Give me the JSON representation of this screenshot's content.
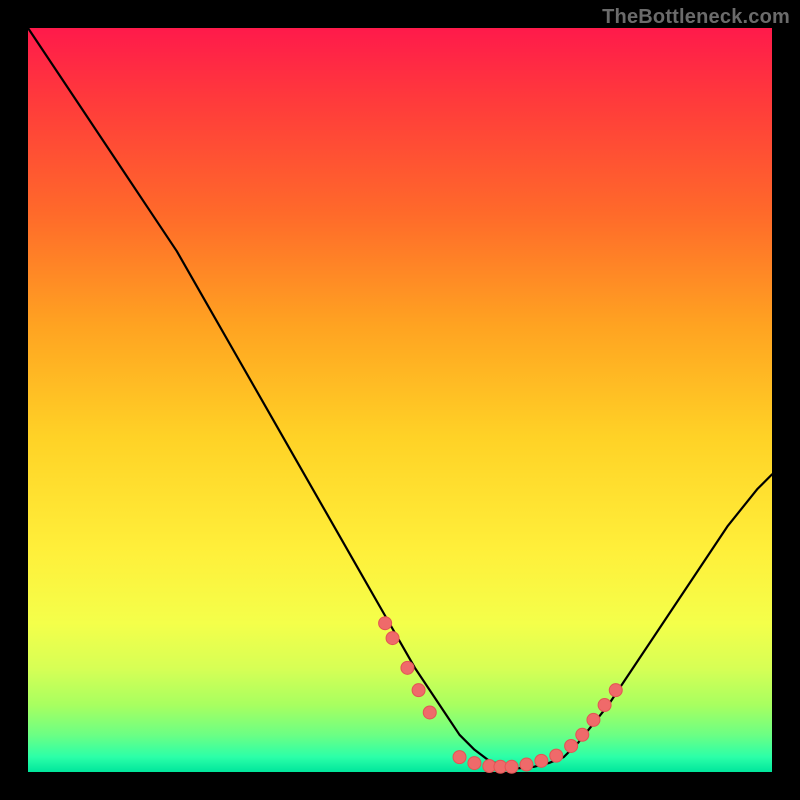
{
  "watermark": "TheBottleneck.com",
  "colors": {
    "background": "#000000",
    "curve": "#000000",
    "dot_fill": "#ef6a6a",
    "dot_stroke": "#e35454"
  },
  "chart_data": {
    "type": "line",
    "title": "",
    "xlabel": "",
    "ylabel": "",
    "xlim": [
      0,
      100
    ],
    "ylim": [
      0,
      100
    ],
    "series": [
      {
        "name": "curve",
        "x": [
          0,
          4,
          8,
          12,
          16,
          20,
          24,
          28,
          32,
          36,
          40,
          44,
          48,
          52,
          56,
          58,
          60,
          62,
          64,
          66,
          68,
          70,
          72,
          74,
          78,
          82,
          86,
          90,
          94,
          98,
          100
        ],
        "y": [
          100,
          94,
          88,
          82,
          76,
          70,
          63,
          56,
          49,
          42,
          35,
          28,
          21,
          14,
          8,
          5,
          3,
          1.5,
          0.8,
          0.5,
          0.7,
          1.2,
          2,
          4,
          9,
          15,
          21,
          27,
          33,
          38,
          40
        ]
      }
    ],
    "dots": [
      {
        "x": 48,
        "y": 20
      },
      {
        "x": 49,
        "y": 18
      },
      {
        "x": 51,
        "y": 14
      },
      {
        "x": 52.5,
        "y": 11
      },
      {
        "x": 54,
        "y": 8
      },
      {
        "x": 58,
        "y": 2
      },
      {
        "x": 60,
        "y": 1.2
      },
      {
        "x": 62,
        "y": 0.8
      },
      {
        "x": 63.5,
        "y": 0.7
      },
      {
        "x": 65,
        "y": 0.7
      },
      {
        "x": 67,
        "y": 1
      },
      {
        "x": 69,
        "y": 1.5
      },
      {
        "x": 71,
        "y": 2.2
      },
      {
        "x": 73,
        "y": 3.5
      },
      {
        "x": 74.5,
        "y": 5
      },
      {
        "x": 76,
        "y": 7
      },
      {
        "x": 77.5,
        "y": 9
      },
      {
        "x": 79,
        "y": 11
      }
    ]
  }
}
